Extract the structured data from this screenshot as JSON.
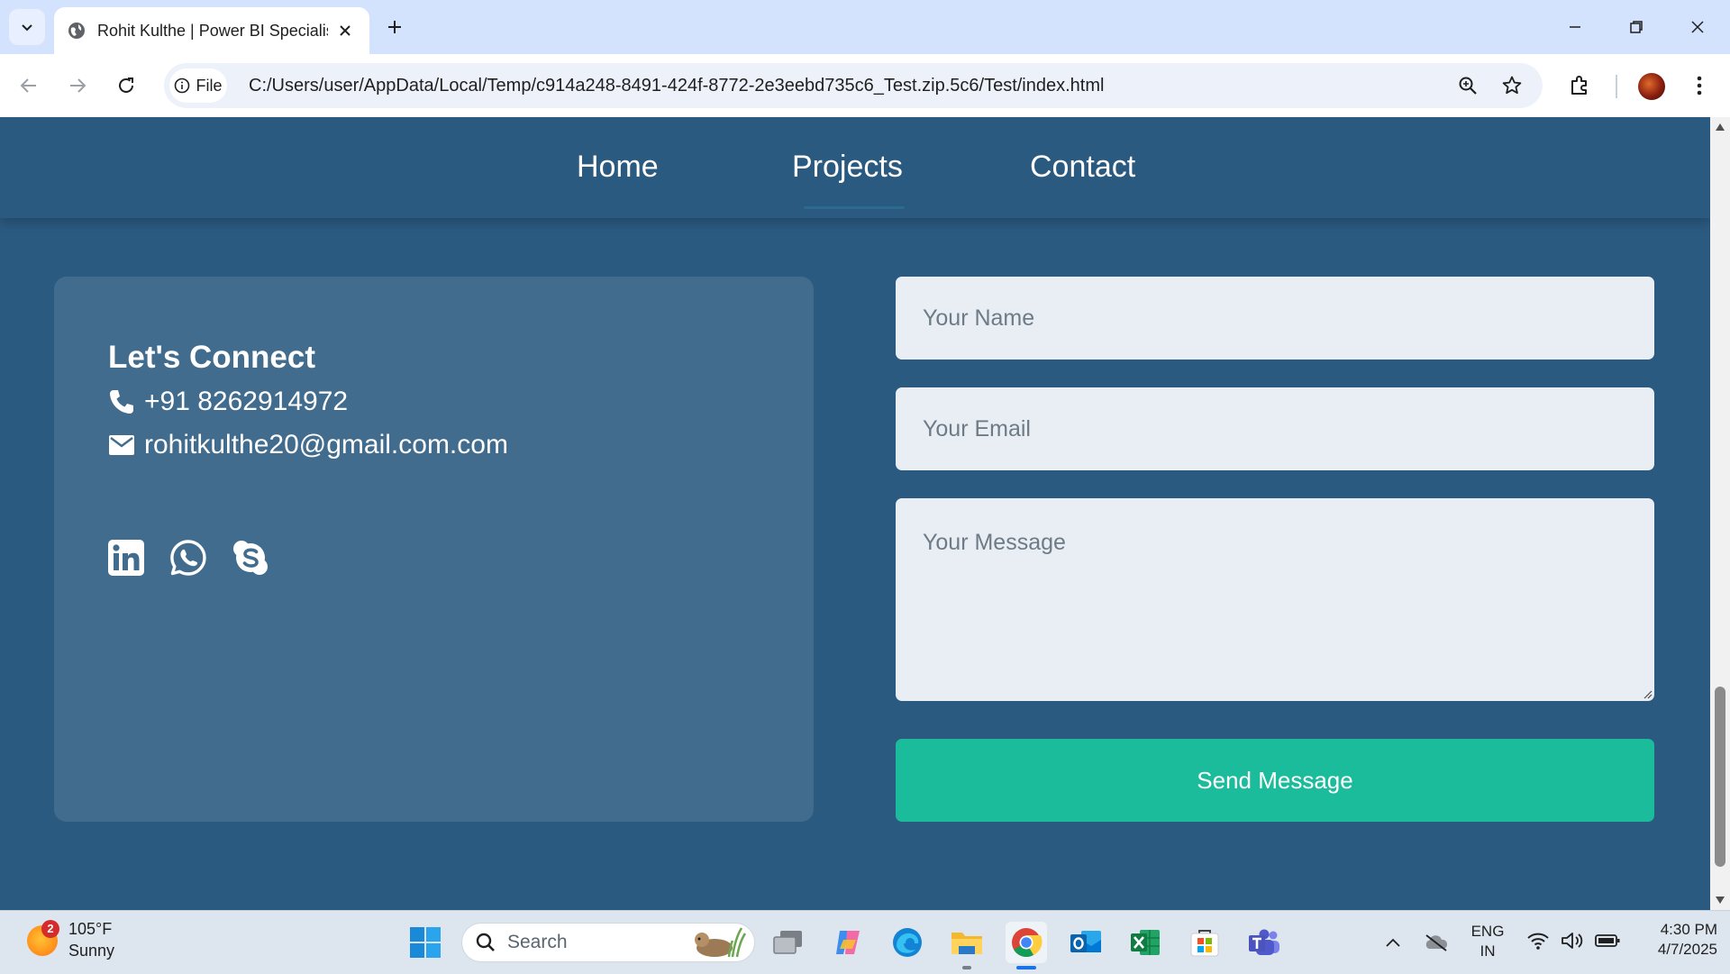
{
  "browser": {
    "tab_title": "Rohit Kulthe | Power BI Specialis",
    "site_chip_label": "File",
    "url": "C:/Users/user/AppData/Local/Temp/c914a248-8491-424f-8772-2e3eebd735c6_Test.zip.5c6/Test/index.html"
  },
  "nav": {
    "links": [
      "Home",
      "Projects",
      "Contact"
    ],
    "active_underline": "Projects"
  },
  "contact_card": {
    "heading": "Let's Connect",
    "phone": "+91 8262914972",
    "email": "rohitkulthe20@gmail.com.com",
    "social_icons": [
      "linkedin-icon",
      "whatsapp-icon",
      "skype-icon"
    ]
  },
  "form": {
    "name_placeholder": "Your Name",
    "email_placeholder": "Your Email",
    "message_placeholder": "Your Message",
    "submit_label": "Send Message"
  },
  "taskbar": {
    "weather_temp": "105°F",
    "weather_condition": "Sunny",
    "weather_badge": "2",
    "search_label": "Search",
    "lang_line1": "ENG",
    "lang_line2": "IN",
    "time": "4:30 PM",
    "date": "4/7/2025"
  },
  "colors": {
    "page_bg": "#2b5a80",
    "card_bg": "#416c8e",
    "field_bg": "#e8eef3",
    "button_bg": "#1bbc9b",
    "tabstrip_bg": "#d3e3fd"
  }
}
